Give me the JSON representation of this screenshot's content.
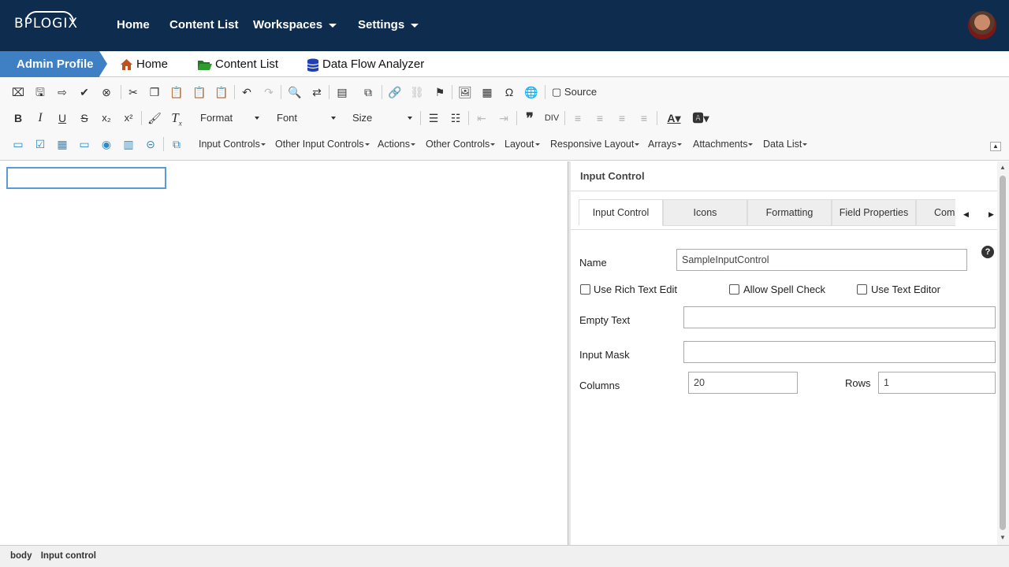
{
  "nav": {
    "logo": "BPLOGIX",
    "items": [
      "Home",
      "Content List",
      "Workspaces",
      "Settings"
    ]
  },
  "breadcrumb": {
    "active": "Admin Profile",
    "links": [
      "Home",
      "Content List",
      "Data Flow Analyzer"
    ]
  },
  "toolbar": {
    "source_label": "Source",
    "format_label": "Format",
    "font_label": "Font",
    "size_label": "Size",
    "menus": [
      "Input Controls",
      "Other Input Controls",
      "Actions",
      "Other Controls",
      "Layout",
      "Responsive Layout",
      "Arrays",
      "Attachments",
      "Data List"
    ]
  },
  "panel": {
    "header": "Input Control",
    "tabs": [
      "Input Control",
      "Icons",
      "Formatting",
      "Field Properties",
      "Com"
    ],
    "name_label": "Name",
    "name_value": "SampleInputControl",
    "checkboxes": [
      "Use Rich Text Edit",
      "Allow Spell Check",
      "Use Text Editor"
    ],
    "empty_text_label": "Empty Text",
    "input_mask_label": "Input Mask",
    "columns_label": "Columns",
    "columns_value": "20",
    "rows_label": "Rows",
    "rows_value": "1"
  },
  "status": {
    "items": [
      "body",
      "Input control"
    ]
  },
  "colors": {
    "nav_bg": "#0d2c4e",
    "breadcrumb_active": "#3f7fc4",
    "home_icon": "#c0521d",
    "folder_icon": "#2e9b2e",
    "db_icon": "#1d3fb8"
  }
}
